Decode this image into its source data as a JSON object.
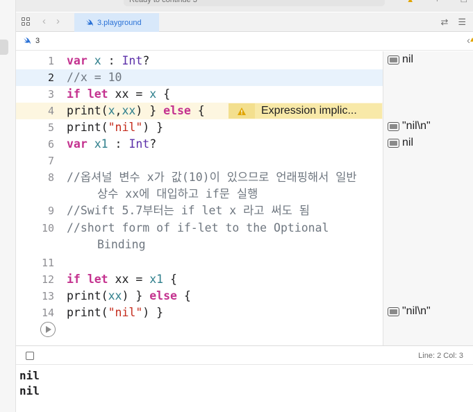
{
  "titlebar": {
    "status": "Ready to continue 3"
  },
  "tabbar": {
    "tab_label": "3.playground"
  },
  "breadcrumb": {
    "label": "3"
  },
  "editor": {
    "lines": [
      {
        "n": "1"
      },
      {
        "n": "2"
      },
      {
        "n": "3"
      },
      {
        "n": "4"
      },
      {
        "n": "5"
      },
      {
        "n": "6"
      },
      {
        "n": "7"
      },
      {
        "n": "8"
      },
      {
        "n": "9"
      },
      {
        "n": "10"
      },
      {
        "n": "11"
      },
      {
        "n": "12"
      },
      {
        "n": "13"
      },
      {
        "n": "14"
      }
    ],
    "tokens": {
      "l1": [
        "var",
        "x",
        " : ",
        "Int",
        "?"
      ],
      "l2": [
        "//x = 10"
      ],
      "l3": [
        "if",
        "let",
        " xx = ",
        "x",
        " {"
      ],
      "l4": [
        "print(",
        "x",
        ",",
        "xx",
        ") } ",
        "else",
        " {"
      ],
      "l5": [
        "print(",
        "\"nil\"",
        ") }"
      ],
      "l6": [
        "var",
        "x1",
        " : ",
        "Int",
        "?"
      ],
      "l8a": "//옵셔널 변수 x가 값(10)이 있으므로 언래핑해서 일반",
      "l8b": "상수 xx에 대입하고 if문 실행",
      "l9": "//Swift 5.7부터는 if let x 라고 써도 됨",
      "l10a": "//short form of if-let to the Optional",
      "l10b": "Binding",
      "l12": [
        "if",
        "let",
        " xx = ",
        "x1",
        " {"
      ],
      "l13": [
        "print(",
        "xx",
        ") } ",
        "else",
        " {"
      ],
      "l14": [
        "print(",
        "\"nil\"",
        ") }"
      ]
    },
    "warning": "Expression implic..."
  },
  "results": {
    "r1": "nil",
    "r5": "\"nil\\n\"",
    "r6": "nil",
    "r14": "\"nil\\n\""
  },
  "debugbar": {
    "line_col": "Line: 2  Col: 3"
  },
  "console": {
    "lines": [
      "nil",
      "nil"
    ]
  },
  "colors": {
    "keyword": "#c4328f",
    "type": "#5b2fa8",
    "identifier": "#2f7f8c",
    "comment": "#6f7780",
    "string": "#c42b1c",
    "tab_active": "#d8e8fa",
    "warning": "#f8e9a8"
  }
}
